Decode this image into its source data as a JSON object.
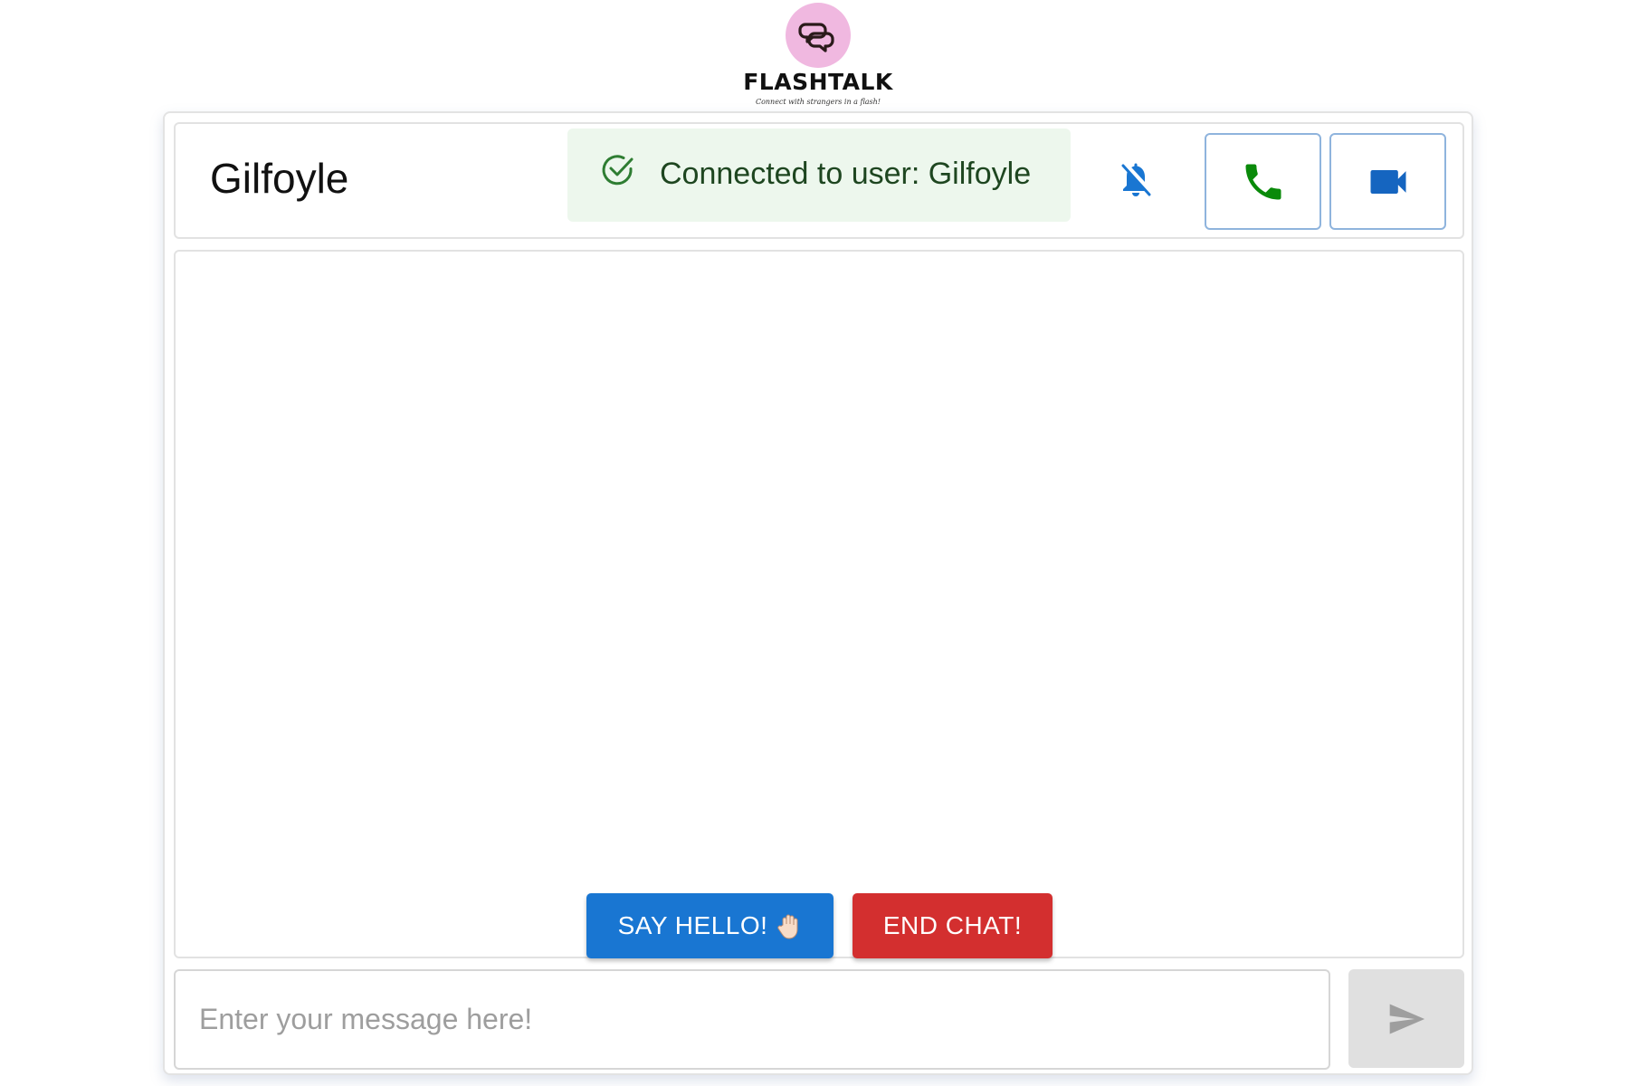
{
  "brand": {
    "name": "FLASHTALK",
    "tagline": "Connect with strangers in a flash!",
    "logo_color": "#f0b8e0"
  },
  "header": {
    "user_name": "Gilfoyle",
    "alert": {
      "text": "Connected to user: Gilfoyle",
      "severity": "success",
      "icon": "check-circle-icon"
    },
    "mute_icon": "bell-off-icon",
    "call_icon": "phone-icon",
    "video_icon": "video-camera-icon"
  },
  "actions": {
    "say_hello_label": "SAY HELLO!",
    "say_hello_icon": "waving-hand-icon",
    "end_chat_label": "END CHAT!"
  },
  "composer": {
    "value": "",
    "placeholder": "Enter your message here!",
    "send_icon": "send-icon",
    "send_enabled": false
  },
  "colors": {
    "primary": "#1976d2",
    "danger": "#d32f2f",
    "success_bg": "#edf7ed",
    "success_text": "#1e4620",
    "phone_green": "#0a8a0a"
  }
}
